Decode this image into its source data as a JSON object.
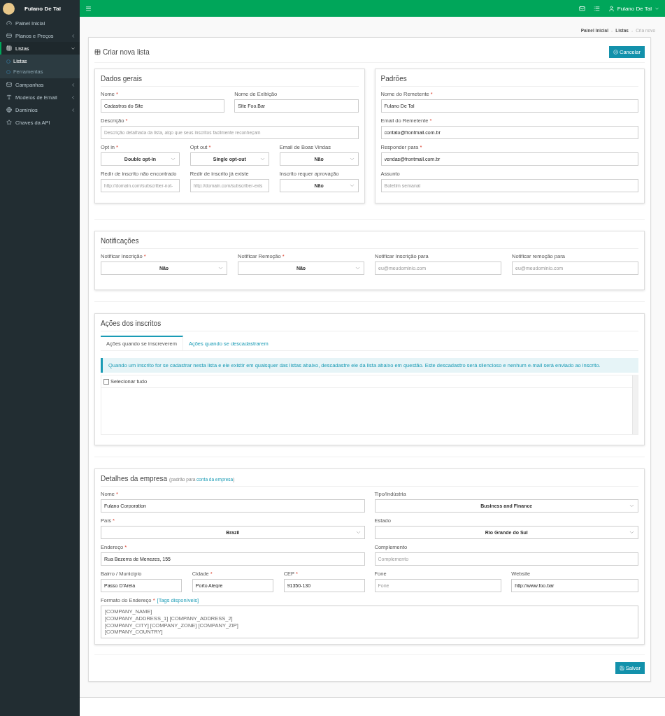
{
  "sidebar": {
    "user": "Fulano De Tal",
    "items": [
      {
        "label": "Painel Inicial",
        "selected": false
      },
      {
        "label": "Planos e Preços",
        "selected": false,
        "expanded": false
      },
      {
        "label": "Listas",
        "selected": true,
        "expanded": true,
        "children": [
          {
            "label": "Listas",
            "selected": true
          },
          {
            "label": "Ferramentas",
            "selected": false
          }
        ]
      },
      {
        "label": "Campanhas",
        "selected": false,
        "expanded": false
      },
      {
        "label": "Modelos de Email",
        "selected": false,
        "expanded": false
      },
      {
        "label": "Domínios",
        "selected": false,
        "expanded": false
      },
      {
        "label": "Chaves da API",
        "selected": false
      }
    ]
  },
  "topbar": {
    "user_menu": "Fulano De Tal"
  },
  "breadcrumb": {
    "separator": "-",
    "items": [
      "Painel Inicial",
      "Listas",
      "Cria novo"
    ]
  },
  "page": {
    "title": "Criar nova lista",
    "cancel_button": "Cancelar",
    "save_button": "Salvar"
  },
  "general": {
    "title": "Dados gerais",
    "rows": [
      [
        {
          "label": "Nome",
          "mark": "*",
          "kind": "input",
          "value": "Cadastros do Site"
        },
        {
          "label": "Nome de Exibição",
          "kind": "input",
          "value": "Site Foo.Bar"
        }
      ],
      [
        {
          "label": "Descrição",
          "mark": "*",
          "kind": "input",
          "placeholder": "Descrição detalhada da lista, algo que seus inscritos facilmente reconheçam"
        }
      ],
      [
        {
          "label": "Opt in",
          "mark": "*",
          "kind": "select",
          "value": "Double opt-in"
        },
        {
          "label": "Opt out",
          "mark": "*",
          "kind": "select",
          "value": "Single opt-out"
        },
        {
          "label": "Email de Boas Vindas",
          "kind": "select",
          "value": "Não"
        }
      ],
      [
        {
          "label": "Redir de inscrito não encontrado",
          "kind": "input",
          "placeholder": "http://domain.com/subscriber-not-"
        },
        {
          "label": "Redir de inscrito já existe",
          "kind": "input",
          "placeholder": "http://domain.com/subscriber-exis"
        },
        {
          "label": "Inscrito requer aprovação",
          "kind": "select",
          "value": "Não"
        }
      ]
    ]
  },
  "defaults": {
    "title": "Padrões",
    "rows": [
      [
        {
          "label": "Nome do Remetente",
          "mark": "*",
          "kind": "input",
          "value": "Fulano De Tal"
        }
      ],
      [
        {
          "label": "Email do Remetente",
          "mark": "*",
          "kind": "input",
          "value": "contato@frontmail.com.br"
        }
      ],
      [
        {
          "label": "Responder para",
          "mark": "*",
          "kind": "input",
          "value": "vendas@frontmail.com.br"
        }
      ],
      [
        {
          "label": "Assunto",
          "kind": "input",
          "placeholder": "Boletim semanal"
        }
      ]
    ]
  },
  "notifications": {
    "title": "Notificações",
    "rows": [
      [
        {
          "label": "Notificar Inscrição",
          "mark": "*",
          "kind": "select",
          "value": "Não"
        },
        {
          "label": "Notificar Remoção",
          "mark": "*",
          "kind": "select",
          "value": "Não"
        },
        {
          "label": "Notificar Inscrição para",
          "kind": "input",
          "placeholder": "eu@meudominio.com"
        },
        {
          "label": "Notificar remoção para",
          "kind": "input",
          "placeholder": "eu@meudominio.com"
        }
      ]
    ]
  },
  "actions": {
    "title": "Ações dos inscritos",
    "tabs": [
      {
        "label": "Ações quando se inscreverem",
        "selected": true
      },
      {
        "label": "Ações quando se descadastrarem",
        "selected": false
      }
    ],
    "alert": "Quando um inscrito for se cadastrar nesta lista e ele existir em quaisquer das listas abaixo, descadastre ele da lista abaixo em questão. Este descadastro será silencioso e nenhum e-mail será enviado ao inscrito.",
    "select_all": {
      "label": "Selecionar tudo",
      "checked": false
    }
  },
  "company": {
    "title": "Detalhes da empresa",
    "note_prefix": "(padrão para",
    "note_link": "conta da empresa",
    "note_suffix": ")",
    "left_rows": [
      [
        {
          "label": "Nome",
          "mark": "*",
          "kind": "input",
          "value": "Fulano Corporation"
        }
      ],
      [
        {
          "label": "País",
          "mark": "*",
          "kind": "select",
          "value": "Brazil"
        }
      ],
      [
        {
          "label": "Endereço",
          "mark": "*",
          "kind": "input",
          "value": "Rua Bezerra de Menezes, 155"
        }
      ],
      [
        {
          "label": "Bairro / Município",
          "kind": "input",
          "value": "Passo D'Areia"
        },
        {
          "label": "Cidade",
          "mark": "*",
          "kind": "input",
          "value": "Porto Alegre"
        },
        {
          "label": "CEP",
          "mark": "*",
          "kind": "input",
          "value": "91350-130"
        }
      ]
    ],
    "right_rows": [
      [
        {
          "label": "Tipo/Indústria",
          "kind": "select",
          "value": "Business and Finance"
        }
      ],
      [
        {
          "label": "Estado",
          "kind": "select",
          "value": "Rio Grande do Sul"
        }
      ],
      [
        {
          "label": "Complemento",
          "kind": "input",
          "placeholder": "Complemento"
        }
      ],
      [
        {
          "label": "Fone",
          "kind": "input",
          "placeholder": "Fone"
        },
        {
          "label": "Website",
          "kind": "input",
          "value": "http://www.foo.bar"
        }
      ]
    ],
    "format": {
      "label": "Formato do Endereço",
      "mark": "*",
      "link": "[Tags disponíveis]",
      "value": "[COMPANY_NAME]\n[COMPANY_ADDRESS_1] [COMPANY_ADDRESS_2]\n[COMPANY_CITY] [COMPANY_ZONE] [COMPANY_ZIP]\n[COMPANY_COUNTRY]"
    }
  }
}
